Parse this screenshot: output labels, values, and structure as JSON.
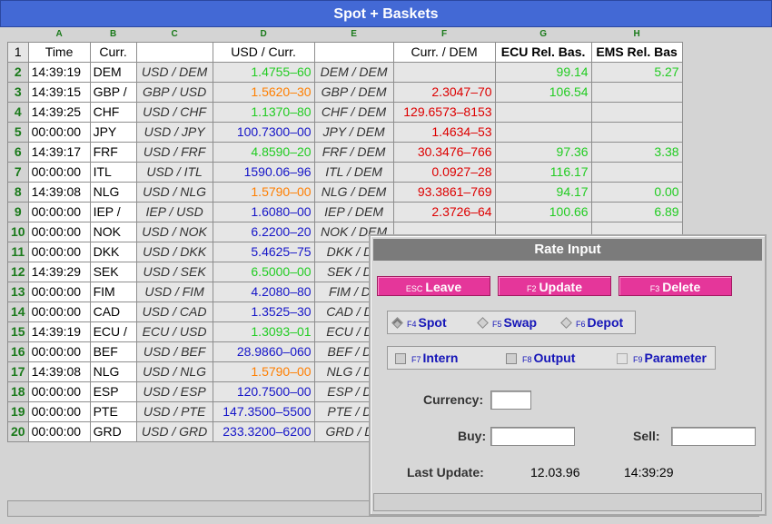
{
  "window": {
    "title": "Spot + Baskets"
  },
  "sheet": {
    "columns": [
      "A",
      "B",
      "C",
      "D",
      "E",
      "F",
      "G",
      "H"
    ],
    "headers": [
      "Time",
      "Curr.",
      "",
      "USD / Curr.",
      "",
      "Curr. / DEM",
      "ECU Rel. Bas.",
      "EMS Rel. Bas"
    ],
    "rows": [
      {
        "n": "2",
        "time": "14:39:19",
        "curr": "DEM",
        "pair": "USD / DEM",
        "usd": "1.4755–60",
        "usd_color": "#22cc22",
        "cpair": "DEM / DEM",
        "dem": "",
        "dem_color": "#dd0000",
        "ecu": "99.14",
        "ems": "5.27"
      },
      {
        "n": "3",
        "time": "14:39:15",
        "curr": "GBP /",
        "pair": "GBP / USD",
        "usd": "1.5620–30",
        "usd_color": "#ff7f00",
        "cpair": "GBP / DEM",
        "dem": "2.3047–70",
        "dem_color": "#dd0000",
        "ecu": "106.54",
        "ems": ""
      },
      {
        "n": "4",
        "time": "14:39:25",
        "curr": "CHF",
        "pair": "USD / CHF",
        "usd": "1.1370–80",
        "usd_color": "#22cc22",
        "cpair": "CHF / DEM",
        "dem": "129.6573–8153",
        "dem_color": "#dd0000",
        "ecu": "",
        "ems": ""
      },
      {
        "n": "5",
        "time": "00:00:00",
        "curr": "JPY",
        "pair": "USD / JPY",
        "usd": "100.7300–00",
        "usd_color": "#1515c8",
        "cpair": "JPY / DEM",
        "dem": "1.4634–53",
        "dem_color": "#dd0000",
        "ecu": "",
        "ems": ""
      },
      {
        "n": "6",
        "time": "14:39:17",
        "curr": "FRF",
        "pair": "USD / FRF",
        "usd": "4.8590–20",
        "usd_color": "#22cc22",
        "cpair": "FRF / DEM",
        "dem": "30.3476–766",
        "dem_color": "#dd0000",
        "ecu": "97.36",
        "ems": "3.38"
      },
      {
        "n": "7",
        "time": "00:00:00",
        "curr": "ITL",
        "pair": "USD / ITL",
        "usd": "1590.06–96",
        "usd_color": "#1515c8",
        "cpair": "ITL / DEM",
        "dem": "0.0927–28",
        "dem_color": "#dd0000",
        "ecu": "116.17",
        "ems": ""
      },
      {
        "n": "8",
        "time": "14:39:08",
        "curr": "NLG",
        "pair": "USD / NLG",
        "usd": "1.5790–00",
        "usd_color": "#ff7f00",
        "cpair": "NLG / DEM",
        "dem": "93.3861–769",
        "dem_color": "#dd0000",
        "ecu": "94.17",
        "ems": "0.00"
      },
      {
        "n": "9",
        "time": "00:00:00",
        "curr": "IEP /",
        "pair": "IEP / USD",
        "usd": "1.6080–00",
        "usd_color": "#1515c8",
        "cpair": "IEP / DEM",
        "dem": "2.3726–64",
        "dem_color": "#dd0000",
        "ecu": "100.66",
        "ems": "6.89"
      },
      {
        "n": "10",
        "time": "00:00:00",
        "curr": "NOK",
        "pair": "USD / NOK",
        "usd": "6.2200–20",
        "usd_color": "#1515c8",
        "cpair": "NOK / DEM",
        "dem": "",
        "dem_color": "#dd0000",
        "ecu": "",
        "ems": ""
      },
      {
        "n": "11",
        "time": "00:00:00",
        "curr": "DKK",
        "pair": "USD / DKK",
        "usd": "5.4625–75",
        "usd_color": "#1515c8",
        "cpair": "DKK / DE",
        "dem": "",
        "dem_color": "#dd0000",
        "ecu": "",
        "ems": ""
      },
      {
        "n": "12",
        "time": "14:39:29",
        "curr": "SEK",
        "pair": "USD / SEK",
        "usd": "6.5000–00",
        "usd_color": "#22cc22",
        "cpair": "SEK / DE",
        "dem": "",
        "dem_color": "#dd0000",
        "ecu": "",
        "ems": ""
      },
      {
        "n": "13",
        "time": "00:00:00",
        "curr": "FIM",
        "pair": "USD / FIM",
        "usd": "4.2080–80",
        "usd_color": "#1515c8",
        "cpair": "FIM / DE",
        "dem": "",
        "dem_color": "#dd0000",
        "ecu": "",
        "ems": ""
      },
      {
        "n": "14",
        "time": "00:00:00",
        "curr": "CAD",
        "pair": "USD / CAD",
        "usd": "1.3525–30",
        "usd_color": "#1515c8",
        "cpair": "CAD / DE",
        "dem": "",
        "dem_color": "#dd0000",
        "ecu": "",
        "ems": ""
      },
      {
        "n": "15",
        "time": "14:39:19",
        "curr": "ECU /",
        "pair": "ECU / USD",
        "usd": "1.3093–01",
        "usd_color": "#22cc22",
        "cpair": "ECU / DE",
        "dem": "",
        "dem_color": "#dd0000",
        "ecu": "",
        "ems": ""
      },
      {
        "n": "16",
        "time": "00:00:00",
        "curr": "BEF",
        "pair": "USD / BEF",
        "usd": "28.9860–060",
        "usd_color": "#1515c8",
        "cpair": "BEF / DE",
        "dem": "",
        "dem_color": "#dd0000",
        "ecu": "",
        "ems": ""
      },
      {
        "n": "17",
        "time": "14:39:08",
        "curr": "NLG",
        "pair": "USD / NLG",
        "usd": "1.5790–00",
        "usd_color": "#ff7f00",
        "cpair": "NLG / DE",
        "dem": "",
        "dem_color": "#dd0000",
        "ecu": "",
        "ems": ""
      },
      {
        "n": "18",
        "time": "00:00:00",
        "curr": "ESP",
        "pair": "USD / ESP",
        "usd": "120.7500–00",
        "usd_color": "#1515c8",
        "cpair": "ESP / DE",
        "dem": "",
        "dem_color": "#dd0000",
        "ecu": "",
        "ems": ""
      },
      {
        "n": "19",
        "time": "00:00:00",
        "curr": "PTE",
        "pair": "USD / PTE",
        "usd": "147.3500–5500",
        "usd_color": "#1515c8",
        "cpair": "PTE / DE",
        "dem": "",
        "dem_color": "#dd0000",
        "ecu": "",
        "ems": ""
      },
      {
        "n": "20",
        "time": "00:00:00",
        "curr": "GRD",
        "pair": "USD / GRD",
        "usd": "233.3200–6200",
        "usd_color": "#1515c8",
        "cpair": "GRD / DE",
        "dem": "",
        "dem_color": "#dd0000",
        "ecu": "",
        "ems": ""
      }
    ]
  },
  "dialog": {
    "title": "Rate Input",
    "buttons": [
      {
        "key": "ESC",
        "label": "Leave"
      },
      {
        "key": "F2",
        "label": "Update"
      },
      {
        "key": "F3",
        "label": "Delete"
      }
    ],
    "radios": [
      {
        "key": "F4",
        "label": "Spot",
        "selected": true
      },
      {
        "key": "F5",
        "label": "Swap",
        "selected": false
      },
      {
        "key": "F6",
        "label": "Depot",
        "selected": false
      }
    ],
    "checks": [
      {
        "key": "F7",
        "label": "Intern"
      },
      {
        "key": "F8",
        "label": "Output"
      },
      {
        "key": "F9",
        "label": "Parameter"
      }
    ],
    "currency_label": "Currency:",
    "currency_value": "",
    "buy_label": "Buy:",
    "buy_value": "",
    "sell_label": "Sell:",
    "sell_value": "",
    "last_update_label": "Last Update:",
    "last_update_date": "12.03.96",
    "last_update_time": "14:39:29"
  }
}
